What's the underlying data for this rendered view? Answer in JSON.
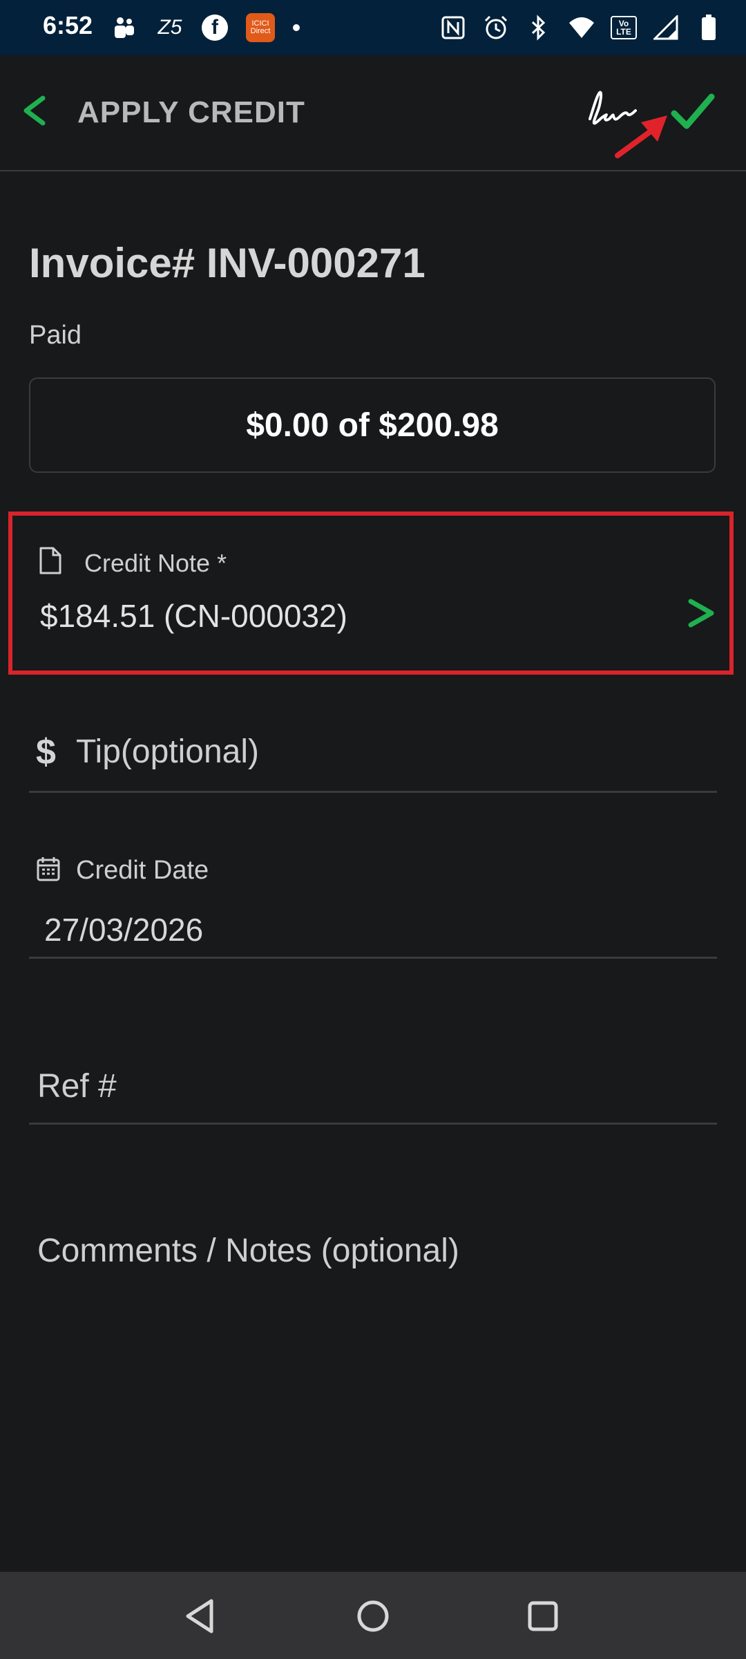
{
  "status_bar": {
    "time": "6:52",
    "left_icons": [
      "teams-icon",
      "z5-icon",
      "facebook-icon",
      "app-notification-icon",
      "dot-icon"
    ],
    "z5_text": "Z5",
    "fb_text": "f",
    "app_text": "ICICI Direct",
    "right_icons": [
      "nfc-icon",
      "alarm-icon",
      "bluetooth-icon",
      "wifi-icon",
      "volte-icon",
      "signal-icon",
      "battery-icon"
    ],
    "volte_text": "Vo LTE"
  },
  "header": {
    "title": "APPLY CREDIT"
  },
  "invoice": {
    "title": "Invoice# INV-000271",
    "paid_label": "Paid",
    "paid_value": "$0.00 of $200.98"
  },
  "credit_note": {
    "label": "Credit Note *",
    "value": "$184.51 (CN-000032)"
  },
  "tip": {
    "icon_text": "$",
    "placeholder": "Tip(optional)"
  },
  "credit_date": {
    "label": "Credit Date",
    "value": "27/03/2026"
  },
  "ref": {
    "placeholder": "Ref #"
  },
  "comments": {
    "placeholder": "Comments / Notes (optional)"
  },
  "colors": {
    "accent_green": "#1fb050",
    "highlight_red": "#d8242a",
    "background": "#18191b"
  }
}
